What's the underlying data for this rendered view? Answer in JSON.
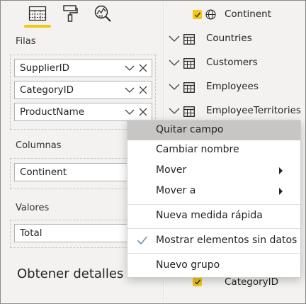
{
  "visuals_toolbar": {
    "tabs": [
      {
        "icon": "fields-table-icon",
        "active": true
      },
      {
        "icon": "format-paint-roller-icon",
        "active": false
      },
      {
        "icon": "analytics-magnifier-icon",
        "active": false
      }
    ],
    "accent_color": "#f2c811"
  },
  "wells": {
    "rows": {
      "label": "Filas",
      "fields": [
        "SupplierID",
        "CategoryID",
        "ProductName"
      ]
    },
    "columns": {
      "label": "Columnas",
      "fields": [
        "Continent"
      ]
    },
    "values": {
      "label": "Valores",
      "fields": [
        "Total"
      ]
    }
  },
  "details": {
    "title": "Obtener detalles"
  },
  "fields_pane": {
    "top_item": {
      "label": "Continent",
      "checked": true
    },
    "tables": [
      "Countries",
      "Customers",
      "Employees",
      "EmployeeTerritories"
    ],
    "bottom_item": {
      "label": "CategoryID",
      "checked": true
    }
  },
  "context_menu": {
    "items": [
      {
        "label": "Quitar campo",
        "highlighted": true
      },
      {
        "label": "Cambiar nombre"
      },
      {
        "label": "Mover",
        "submenu": true
      },
      {
        "label": "Mover a",
        "submenu": true
      },
      {
        "label": "Nueva medida rápida"
      },
      {
        "label": "Mostrar elementos sin datos",
        "checked": true
      },
      {
        "label": "Nuevo grupo"
      }
    ]
  }
}
